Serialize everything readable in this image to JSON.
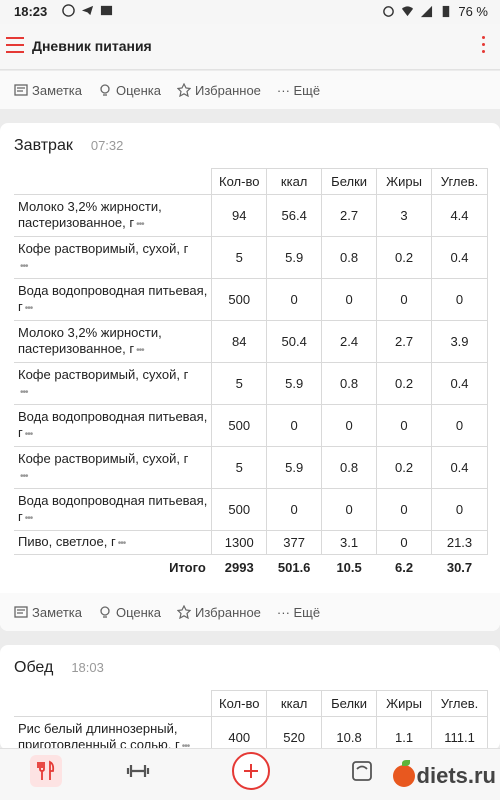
{
  "status_bar": {
    "time": "18:23",
    "battery": "76 %"
  },
  "app_bar": {
    "title": "Дневник питания"
  },
  "actions": {
    "note": "Заметка",
    "rating": "Оценка",
    "favorites": "Избранное",
    "more": "··· Ещё"
  },
  "columns": [
    "Кол-во",
    "ккал",
    "Белки",
    "Жиры",
    "Углев."
  ],
  "breakfast": {
    "name": "Завтрак",
    "time": "07:32",
    "rows": [
      {
        "name": "Молоко 3,2% жирности, пастеризованное, г",
        "qty": "94",
        "kcal": "56.4",
        "protein": "2.7",
        "fat": "3",
        "carbs": "4.4"
      },
      {
        "name": "Кофе растворимый, сухой, г",
        "qty": "5",
        "kcal": "5.9",
        "protein": "0.8",
        "fat": "0.2",
        "carbs": "0.4"
      },
      {
        "name": "Вода водопроводная питьевая, г",
        "qty": "500",
        "kcal": "0",
        "protein": "0",
        "fat": "0",
        "carbs": "0"
      },
      {
        "name": "Молоко 3,2% жирности, пастеризованное, г",
        "qty": "84",
        "kcal": "50.4",
        "protein": "2.4",
        "fat": "2.7",
        "carbs": "3.9"
      },
      {
        "name": "Кофе растворимый, сухой, г",
        "qty": "5",
        "kcal": "5.9",
        "protein": "0.8",
        "fat": "0.2",
        "carbs": "0.4"
      },
      {
        "name": "Вода водопроводная питьевая, г",
        "qty": "500",
        "kcal": "0",
        "protein": "0",
        "fat": "0",
        "carbs": "0"
      },
      {
        "name": "Кофе растворимый, сухой, г",
        "qty": "5",
        "kcal": "5.9",
        "protein": "0.8",
        "fat": "0.2",
        "carbs": "0.4"
      },
      {
        "name": "Вода водопроводная питьевая, г",
        "qty": "500",
        "kcal": "0",
        "protein": "0",
        "fat": "0",
        "carbs": "0"
      },
      {
        "name": "Пиво, светлое, г",
        "qty": "1300",
        "kcal": "377",
        "protein": "3.1",
        "fat": "0",
        "carbs": "21.3"
      }
    ],
    "total": {
      "label": "Итого",
      "qty": "2993",
      "kcal": "501.6",
      "protein": "10.5",
      "fat": "6.2",
      "carbs": "30.7"
    }
  },
  "lunch": {
    "name": "Обед",
    "time": "18:03",
    "rows": [
      {
        "name": "Рис белый длиннозерный, приготовленный с солью, г",
        "qty": "400",
        "kcal": "520",
        "protein": "10.8",
        "fat": "1.1",
        "carbs": "111.1"
      }
    ]
  },
  "logo": {
    "text": "diets.ru"
  },
  "colors": {
    "accent": "#e53935",
    "background": "#ececec",
    "card": "#ffffff"
  }
}
